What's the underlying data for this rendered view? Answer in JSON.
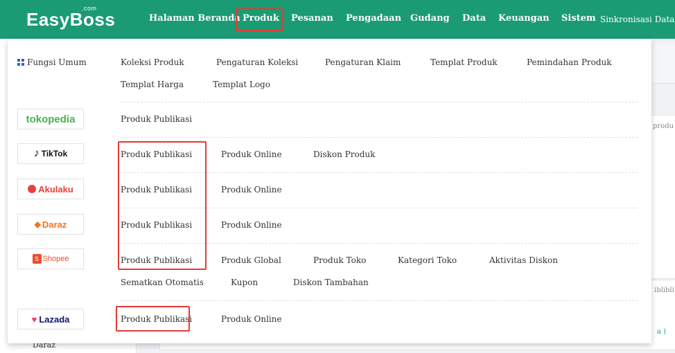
{
  "logo": {
    "text": "EasyBoss",
    "suffix": ".com"
  },
  "nav": {
    "halaman_beranda": "Halaman Beranda",
    "produk": "Produk",
    "pesanan": "Pesanan",
    "pengadaan": "Pengadaan",
    "gudang": "Gudang",
    "data": "Data",
    "keuangan": "Keuangan",
    "sistem": "Sistem",
    "sinkronisasi": "Sinkronisasi Data"
  },
  "background": {
    "sidebar_label": "Daraz",
    "peek_produ": "produ",
    "peek_iblibli": "iblibli",
    "peek_paren": "a )"
  },
  "menu": {
    "fungsi_umum": {
      "label": "Fungsi Umum",
      "links": [
        "Koleksi Produk",
        "Pengaturan Koleksi",
        "Pengaturan Klaim",
        "Templat Produk",
        "Pemindahan Produk",
        "Templat Harga",
        "Templat Logo"
      ]
    },
    "tokopedia": {
      "brand": "tokopedia",
      "links": [
        "Produk Publikasi"
      ]
    },
    "tiktok": {
      "brand": "TikTok",
      "links": [
        "Produk Publikasi",
        "Produk Online",
        "Diskon Produk"
      ]
    },
    "akulaku": {
      "brand": "Akulaku",
      "links": [
        "Produk Publikasi",
        "Produk Online"
      ]
    },
    "daraz": {
      "brand": "Daraz",
      "links": [
        "Produk Publikasi",
        "Produk Online"
      ]
    },
    "shopee": {
      "brand": "Shopee",
      "links": [
        "Produk Publikasi",
        "Produk Global",
        "Produk Toko",
        "Kategori Toko",
        "Aktivitas Diskon",
        "Sematkan Otomatis",
        "Kupon",
        "Diskon Tambahan"
      ]
    },
    "lazada": {
      "brand": "Lazada",
      "links": [
        "Produk Publikasi",
        "Produk Online"
      ]
    }
  },
  "colors": {
    "nav_bg": "#1a9b73",
    "highlight": "#e53935",
    "tokopedia": "#42b549",
    "akulaku": "#e8413c",
    "daraz": "#f57224",
    "shopee": "#ee4d2d",
    "lazada": "#0f146d"
  }
}
